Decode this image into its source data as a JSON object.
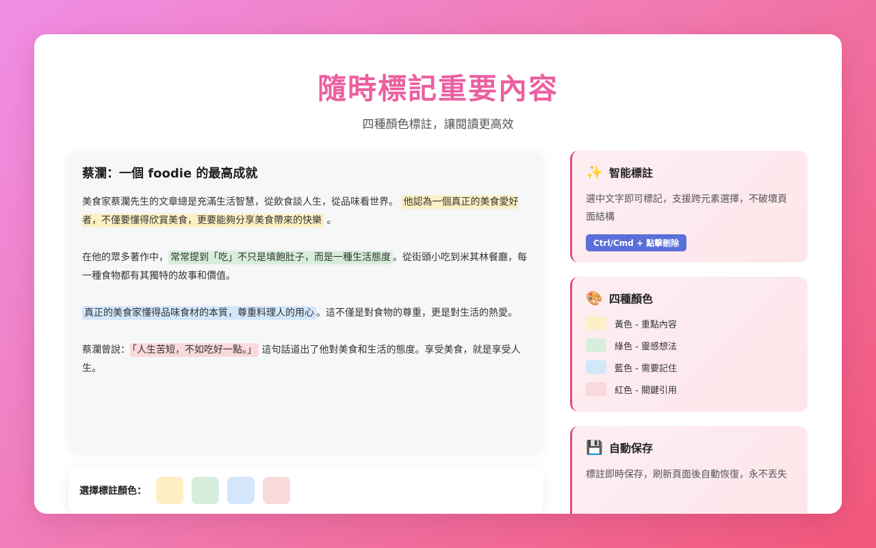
{
  "header": {
    "title": "隨時標記重要內容",
    "subtitle": "四種顏色標註，讓閱讀更高效"
  },
  "article": {
    "title": "蔡瀾：一個 foodie 的最高成就",
    "p1_a": "美食家蔡瀾先生的文章總是充滿生活智慧，從飲食談人生，從品味看世界。",
    "p1_hl": "他認為一個真正的美食愛好者，不僅要懂得欣賞美食，更要能夠分享美食帶來的快樂",
    "p1_b": "。",
    "p2_a": "在他的眾多著作中，",
    "p2_hl": "常常提到「吃」不只是填飽肚子，而是一種生活態度",
    "p2_b": "。從街頭小吃到米其林餐廳，每一種食物都有其獨特的故事和價值。",
    "p3_hl": "真正的美食家懂得品味食材的本質，尊重料理人的用心",
    "p3_b": "。這不僅是對食物的尊重，更是對生活的熱愛。",
    "p4_a": "蔡瀾曾說：",
    "p4_hl": "「人生苦短，不如吃好一點。」",
    "p4_b": "這句話道出了他對美食和生活的態度。享受美食，就是享受人生。"
  },
  "picker": {
    "label": "選擇標註顏色：",
    "swatches": [
      "#fdf0c4",
      "#d8eedc",
      "#d3e7fb",
      "#f9d9dc"
    ]
  },
  "features": {
    "smart": {
      "icon": "sparkles-icon",
      "glyph": "✨",
      "title": "智能標註",
      "desc": "選中文字即可標記，支援跨元素選擇，不破壞頁面結構",
      "shortcut": "Ctrl/Cmd + 點擊刪除"
    },
    "colors": {
      "icon": "palette-icon",
      "glyph": "🎨",
      "title": "四種顏色",
      "items": [
        {
          "label": "黃色 - 重點內容",
          "color": "#fdf0c4"
        },
        {
          "label": "綠色 - 靈感想法",
          "color": "#d8eedc"
        },
        {
          "label": "藍色 - 需要記住",
          "color": "#d3e7fb"
        },
        {
          "label": "紅色 - 關鍵引用",
          "color": "#f9d9dc"
        }
      ]
    },
    "save": {
      "icon": "floppy-disk-icon",
      "glyph": "💾",
      "title": "自動保存",
      "desc": "標註即時保存，刷新頁面後自動恢復，永不丟失"
    }
  },
  "colors": {
    "accent_title": "#ec5fa0",
    "card_border": "#e04a70",
    "shortcut_badge": "#5b6fd8"
  }
}
